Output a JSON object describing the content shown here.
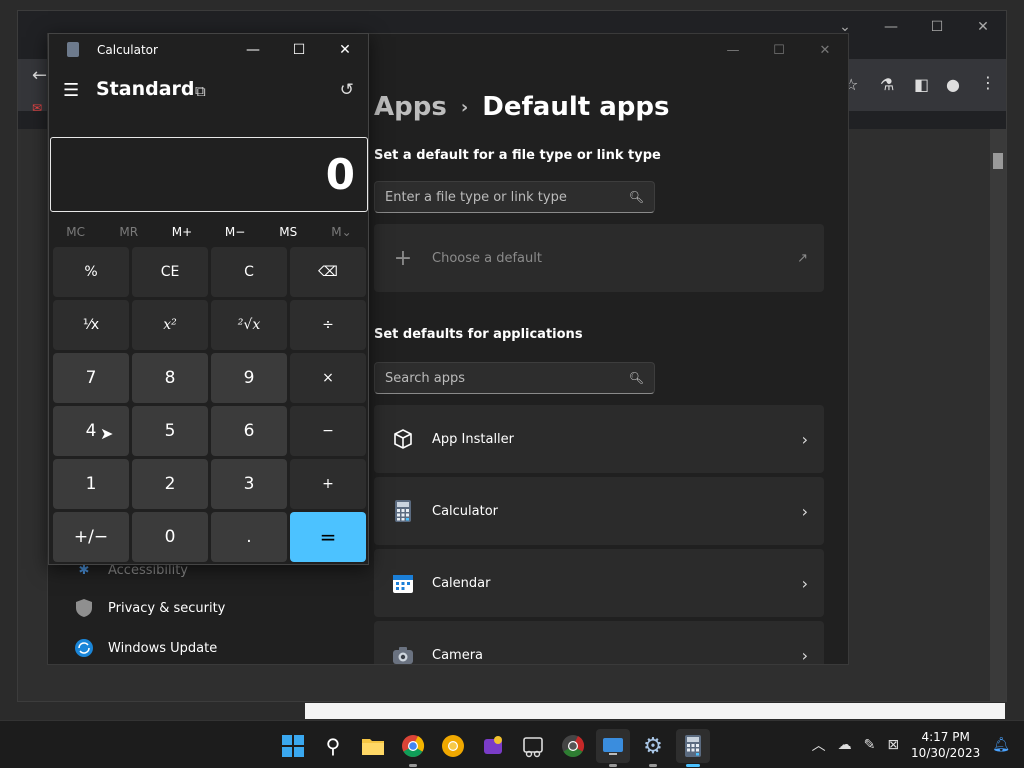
{
  "calculator": {
    "title": "Calculator",
    "mode": "Standard",
    "display": "0",
    "memory": [
      "MC",
      "MR",
      "M+",
      "M−",
      "MS",
      "M⌄"
    ],
    "keys": [
      "%",
      "CE",
      "C",
      "⌫",
      "⅟x",
      "x²",
      "²√x",
      "÷",
      "7",
      "8",
      "9",
      "×",
      "4",
      "5",
      "6",
      "−",
      "1",
      "2",
      "3",
      "+",
      "+/−",
      "0",
      ".",
      "="
    ]
  },
  "settings": {
    "breadcrumb_parent": "Apps",
    "breadcrumb_current": "Default apps",
    "filetype_section": "Set a default for a file type or link type",
    "filetype_placeholder": "Enter a file type or link type",
    "choose_default": "Choose a default",
    "apps_section": "Set defaults for applications",
    "apps_placeholder": "Search apps",
    "apps": [
      {
        "label": "App Installer"
      },
      {
        "label": "Calculator"
      },
      {
        "label": "Calendar"
      },
      {
        "label": "Camera"
      }
    ],
    "nav": [
      {
        "label": "Accessibility"
      },
      {
        "label": "Privacy & security"
      },
      {
        "label": "Windows Update"
      }
    ]
  },
  "taskbar": {
    "time": "4:17 PM",
    "date": "10/30/2023"
  },
  "colors": {
    "accent": "#4cc2ff",
    "background": "#202020"
  }
}
